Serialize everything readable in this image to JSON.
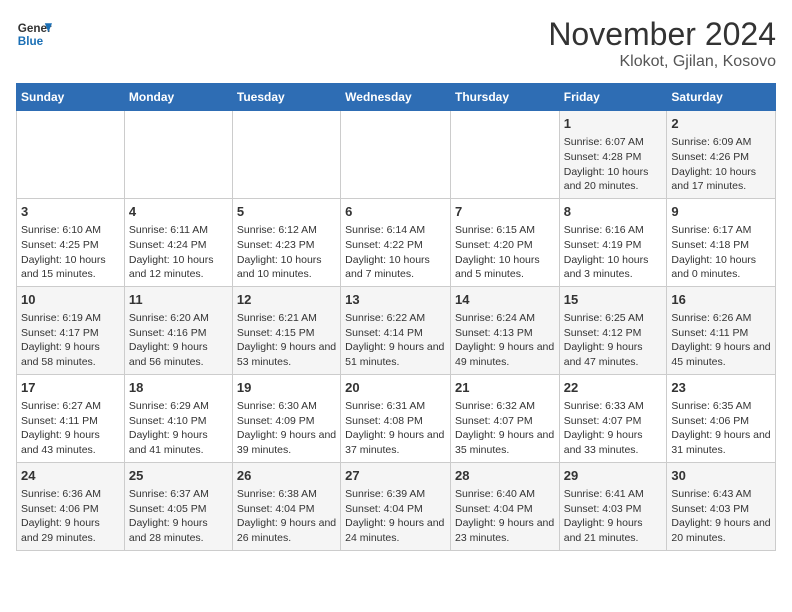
{
  "header": {
    "logo_line1": "General",
    "logo_line2": "Blue",
    "month": "November 2024",
    "location": "Klokot, Gjilan, Kosovo"
  },
  "weekdays": [
    "Sunday",
    "Monday",
    "Tuesday",
    "Wednesday",
    "Thursday",
    "Friday",
    "Saturday"
  ],
  "weeks": [
    [
      {
        "day": "",
        "content": ""
      },
      {
        "day": "",
        "content": ""
      },
      {
        "day": "",
        "content": ""
      },
      {
        "day": "",
        "content": ""
      },
      {
        "day": "",
        "content": ""
      },
      {
        "day": "1",
        "content": "Sunrise: 6:07 AM\nSunset: 4:28 PM\nDaylight: 10 hours and 20 minutes."
      },
      {
        "day": "2",
        "content": "Sunrise: 6:09 AM\nSunset: 4:26 PM\nDaylight: 10 hours and 17 minutes."
      }
    ],
    [
      {
        "day": "3",
        "content": "Sunrise: 6:10 AM\nSunset: 4:25 PM\nDaylight: 10 hours and 15 minutes."
      },
      {
        "day": "4",
        "content": "Sunrise: 6:11 AM\nSunset: 4:24 PM\nDaylight: 10 hours and 12 minutes."
      },
      {
        "day": "5",
        "content": "Sunrise: 6:12 AM\nSunset: 4:23 PM\nDaylight: 10 hours and 10 minutes."
      },
      {
        "day": "6",
        "content": "Sunrise: 6:14 AM\nSunset: 4:22 PM\nDaylight: 10 hours and 7 minutes."
      },
      {
        "day": "7",
        "content": "Sunrise: 6:15 AM\nSunset: 4:20 PM\nDaylight: 10 hours and 5 minutes."
      },
      {
        "day": "8",
        "content": "Sunrise: 6:16 AM\nSunset: 4:19 PM\nDaylight: 10 hours and 3 minutes."
      },
      {
        "day": "9",
        "content": "Sunrise: 6:17 AM\nSunset: 4:18 PM\nDaylight: 10 hours and 0 minutes."
      }
    ],
    [
      {
        "day": "10",
        "content": "Sunrise: 6:19 AM\nSunset: 4:17 PM\nDaylight: 9 hours and 58 minutes."
      },
      {
        "day": "11",
        "content": "Sunrise: 6:20 AM\nSunset: 4:16 PM\nDaylight: 9 hours and 56 minutes."
      },
      {
        "day": "12",
        "content": "Sunrise: 6:21 AM\nSunset: 4:15 PM\nDaylight: 9 hours and 53 minutes."
      },
      {
        "day": "13",
        "content": "Sunrise: 6:22 AM\nSunset: 4:14 PM\nDaylight: 9 hours and 51 minutes."
      },
      {
        "day": "14",
        "content": "Sunrise: 6:24 AM\nSunset: 4:13 PM\nDaylight: 9 hours and 49 minutes."
      },
      {
        "day": "15",
        "content": "Sunrise: 6:25 AM\nSunset: 4:12 PM\nDaylight: 9 hours and 47 minutes."
      },
      {
        "day": "16",
        "content": "Sunrise: 6:26 AM\nSunset: 4:11 PM\nDaylight: 9 hours and 45 minutes."
      }
    ],
    [
      {
        "day": "17",
        "content": "Sunrise: 6:27 AM\nSunset: 4:11 PM\nDaylight: 9 hours and 43 minutes."
      },
      {
        "day": "18",
        "content": "Sunrise: 6:29 AM\nSunset: 4:10 PM\nDaylight: 9 hours and 41 minutes."
      },
      {
        "day": "19",
        "content": "Sunrise: 6:30 AM\nSunset: 4:09 PM\nDaylight: 9 hours and 39 minutes."
      },
      {
        "day": "20",
        "content": "Sunrise: 6:31 AM\nSunset: 4:08 PM\nDaylight: 9 hours and 37 minutes."
      },
      {
        "day": "21",
        "content": "Sunrise: 6:32 AM\nSunset: 4:07 PM\nDaylight: 9 hours and 35 minutes."
      },
      {
        "day": "22",
        "content": "Sunrise: 6:33 AM\nSunset: 4:07 PM\nDaylight: 9 hours and 33 minutes."
      },
      {
        "day": "23",
        "content": "Sunrise: 6:35 AM\nSunset: 4:06 PM\nDaylight: 9 hours and 31 minutes."
      }
    ],
    [
      {
        "day": "24",
        "content": "Sunrise: 6:36 AM\nSunset: 4:06 PM\nDaylight: 9 hours and 29 minutes."
      },
      {
        "day": "25",
        "content": "Sunrise: 6:37 AM\nSunset: 4:05 PM\nDaylight: 9 hours and 28 minutes."
      },
      {
        "day": "26",
        "content": "Sunrise: 6:38 AM\nSunset: 4:04 PM\nDaylight: 9 hours and 26 minutes."
      },
      {
        "day": "27",
        "content": "Sunrise: 6:39 AM\nSunset: 4:04 PM\nDaylight: 9 hours and 24 minutes."
      },
      {
        "day": "28",
        "content": "Sunrise: 6:40 AM\nSunset: 4:04 PM\nDaylight: 9 hours and 23 minutes."
      },
      {
        "day": "29",
        "content": "Sunrise: 6:41 AM\nSunset: 4:03 PM\nDaylight: 9 hours and 21 minutes."
      },
      {
        "day": "30",
        "content": "Sunrise: 6:43 AM\nSunset: 4:03 PM\nDaylight: 9 hours and 20 minutes."
      }
    ]
  ]
}
